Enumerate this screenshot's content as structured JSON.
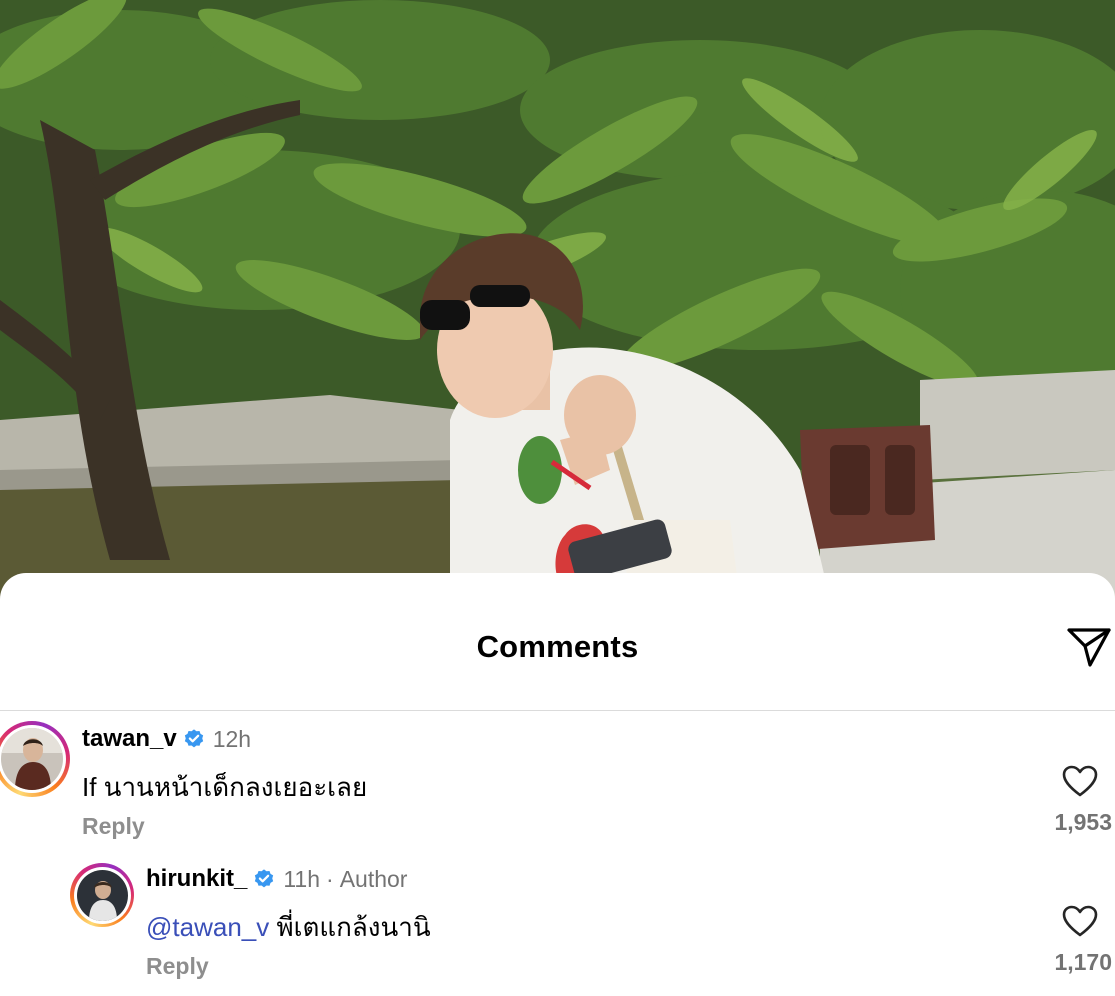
{
  "post": {
    "image_description_icon": "photo-icon"
  },
  "sheet": {
    "title": "Comments",
    "share_icon": "paper-plane-icon"
  },
  "comments": [
    {
      "username": "tawan_v",
      "verified": true,
      "time": "12h",
      "text": "If นานหน้าเด็กลงเยอะเลย",
      "reply_label": "Reply",
      "like_count": "1,953",
      "like_icon": "heart-icon"
    },
    {
      "username": "hirunkit_",
      "verified": true,
      "time": "11h",
      "separator": "·",
      "author_label": "Author",
      "mention": "@tawan_v",
      "text": "พี่เตแกล้งนานิ",
      "reply_label": "Reply",
      "like_count": "1,170",
      "like_icon": "heart-icon"
    }
  ],
  "colors": {
    "verified": "#3897f0",
    "mention": "#3a4fb8",
    "muted": "#737373"
  }
}
